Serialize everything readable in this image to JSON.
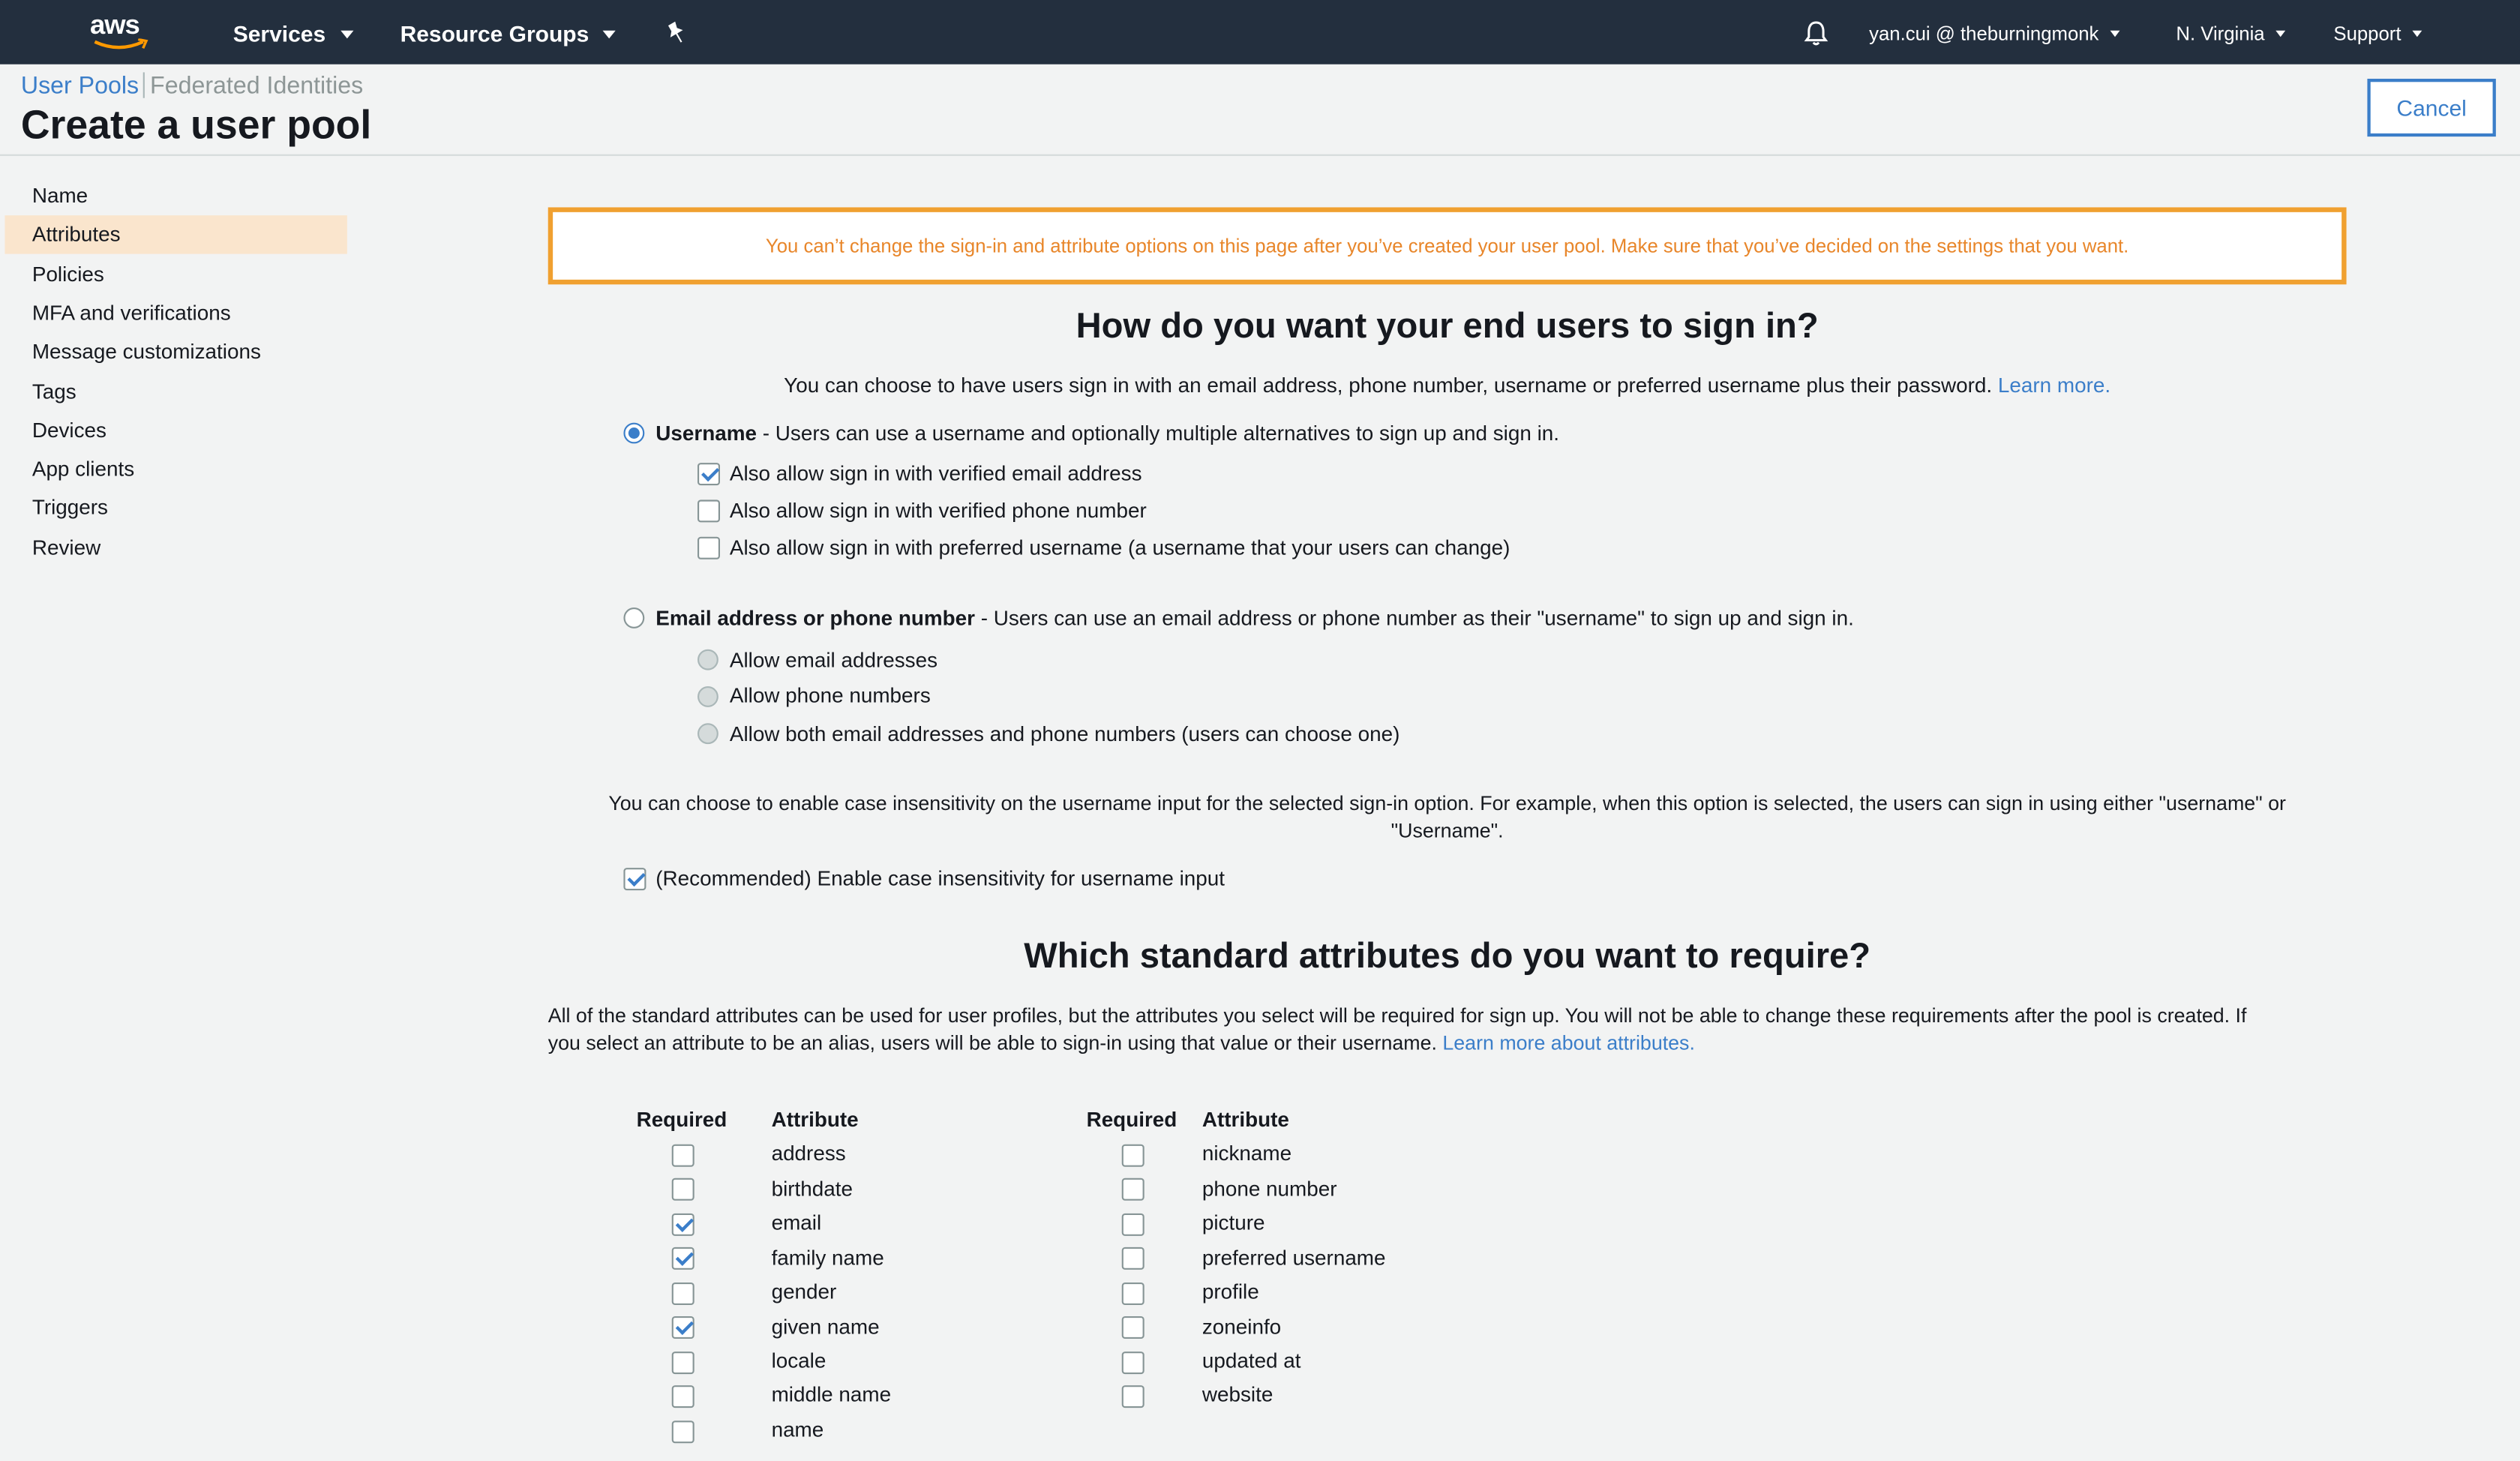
{
  "topbar": {
    "logo": "aws",
    "services": "Services",
    "resource_groups": "Resource Groups",
    "pin_icon": "pin-icon",
    "bell_icon": "bell-icon",
    "account": "yan.cui @ theburningmonk",
    "region": "N. Virginia",
    "support": "Support"
  },
  "header": {
    "breadcrumb_user_pools": "User Pools",
    "breadcrumb_federated": "Federated Identities",
    "title": "Create a user pool",
    "cancel": "Cancel"
  },
  "sidebar": {
    "items": [
      {
        "label": "Name",
        "active": false
      },
      {
        "label": "Attributes",
        "active": true
      },
      {
        "label": "Policies",
        "active": false
      },
      {
        "label": "MFA and verifications",
        "active": false
      },
      {
        "label": "Message customizations",
        "active": false
      },
      {
        "label": "Tags",
        "active": false
      },
      {
        "label": "Devices",
        "active": false
      },
      {
        "label": "App clients",
        "active": false
      },
      {
        "label": "Triggers",
        "active": false
      },
      {
        "label": "Review",
        "active": false
      }
    ]
  },
  "main": {
    "warning": "You can’t change the sign-in and attribute options on this page after you’ve created your user pool. Make sure that you’ve decided on the settings that you want.",
    "signin_heading": "How do you want your end users to sign in?",
    "signin_intro": "You can choose to have users sign in with an email address, phone number, username or preferred username plus their password.",
    "learn_more": "Learn more.",
    "username_option": {
      "title": "Username",
      "desc": " - Users can use a username and optionally multiple alternatives to sign up and sign in.",
      "checked": true,
      "suboptions": [
        {
          "label": "Also allow sign in with verified email address",
          "checked": true
        },
        {
          "label": "Also allow sign in with verified phone number",
          "checked": false
        },
        {
          "label": "Also allow sign in with preferred username (a username that your users can change)",
          "checked": false
        }
      ]
    },
    "email_option": {
      "title": "Email address or phone number",
      "desc": " - Users can use an email address or phone number as their \"username\" to sign up and sign in.",
      "checked": false,
      "suboptions": [
        {
          "label": "Allow email addresses"
        },
        {
          "label": "Allow phone numbers"
        },
        {
          "label": "Allow both email addresses and phone numbers (users can choose one)"
        }
      ]
    },
    "case_text_line1": "You can choose to enable case insensitivity on the username input for the selected sign-in option. For example, when this option is selected, the users can sign in using either \"username\" or",
    "case_text_line2": "\"Username\".",
    "case_checkbox": {
      "label": "(Recommended) Enable case insensitivity for username input",
      "checked": true
    },
    "attrs_heading": "Which standard attributes do you want to require?",
    "attrs_text_line1": "All of the standard attributes can be used for user profiles, but the attributes you select will be required for sign up. You will not be able to change these requirements after the pool is created. If",
    "attrs_text_line2": "you select an attribute to be an alias, users will be able to sign-in using that value or their username.",
    "attrs_link": "Learn more about attributes.",
    "col_required": "Required",
    "col_attribute": "Attribute",
    "attrs_left": [
      {
        "name": "address",
        "required": false
      },
      {
        "name": "birthdate",
        "required": false
      },
      {
        "name": "email",
        "required": true
      },
      {
        "name": "family name",
        "required": true
      },
      {
        "name": "gender",
        "required": false
      },
      {
        "name": "given name",
        "required": true
      },
      {
        "name": "locale",
        "required": false
      },
      {
        "name": "middle name",
        "required": false
      },
      {
        "name": "name",
        "required": false
      }
    ],
    "attrs_right": [
      {
        "name": "nickname",
        "required": false
      },
      {
        "name": "phone number",
        "required": false
      },
      {
        "name": "picture",
        "required": false
      },
      {
        "name": "preferred username",
        "required": false
      },
      {
        "name": "profile",
        "required": false
      },
      {
        "name": "zoneinfo",
        "required": false
      },
      {
        "name": "updated at",
        "required": false
      },
      {
        "name": "website",
        "required": false
      }
    ]
  }
}
